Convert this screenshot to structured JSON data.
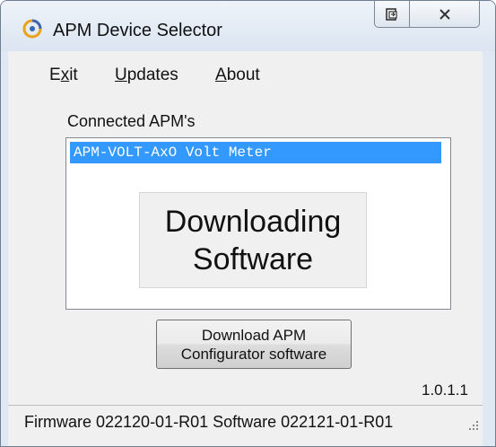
{
  "window": {
    "title": "APM Device Selector",
    "icon": "apm-logo-icon",
    "caption_buttons": [
      "restore-icon",
      "close-icon"
    ]
  },
  "menu": {
    "items": [
      {
        "label": "Exit",
        "mnemonic": "x"
      },
      {
        "label": "Updates",
        "mnemonic": "U"
      },
      {
        "label": "About",
        "mnemonic": "A"
      }
    ]
  },
  "devices": {
    "label": "Connected APM's",
    "items": [
      {
        "text": "APM-VOLT-AxO Volt Meter",
        "selected": true
      }
    ]
  },
  "overlay": {
    "line1": "Downloading",
    "line2": "Software"
  },
  "download_button": {
    "line1": "Download APM",
    "line2": "Configurator software"
  },
  "version": "1.0.1.1",
  "status": {
    "text": "Firmware 022120-01-R01  Software 022121-01-R01"
  },
  "colors": {
    "selection": "#3399ff",
    "window_frame": "#dfe8f3",
    "client_bg": "#f0f0f0"
  }
}
